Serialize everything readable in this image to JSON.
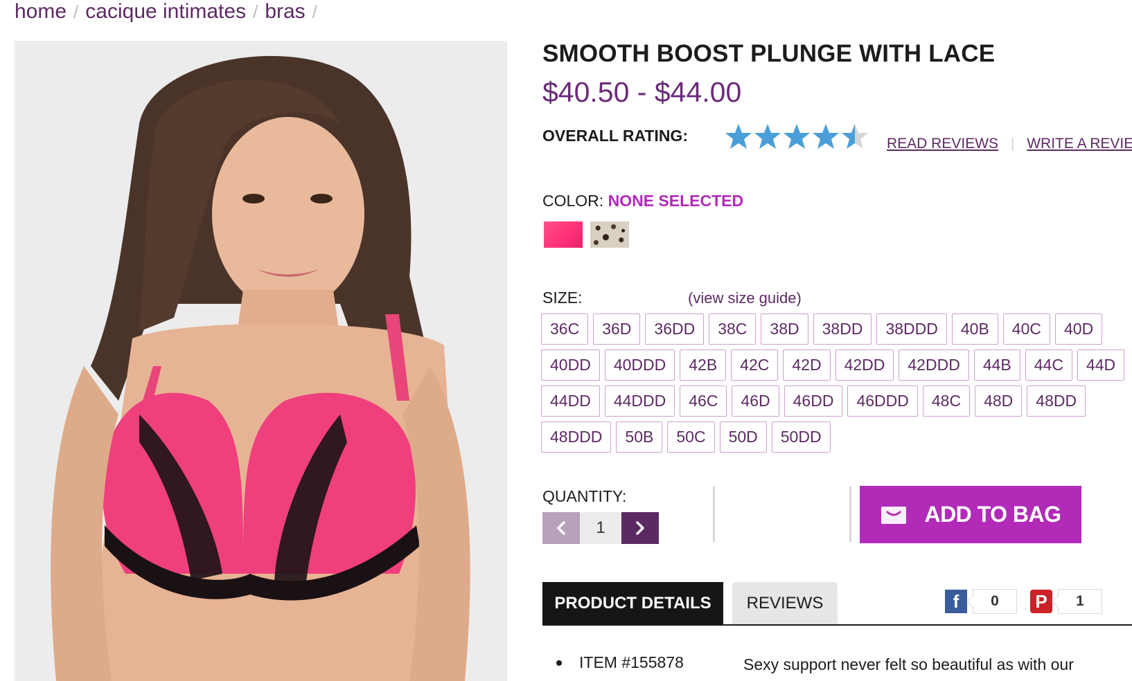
{
  "breadcrumb": {
    "items": [
      "home",
      "cacique intimates",
      "bras"
    ],
    "separator": "/"
  },
  "product": {
    "title": "SMOOTH BOOST PLUNGE WITH LACE",
    "price": "$40.50 - $44.00",
    "image_alt_icon": "product-photo"
  },
  "rating": {
    "label": "OVERALL RATING:",
    "value": 4.5,
    "max": 5,
    "read_reviews": "READ REVIEWS",
    "separator": "|",
    "write_review": "WRITE A REVIEW"
  },
  "color": {
    "label": "COLOR:",
    "selected": "NONE SELECTED",
    "swatches": [
      {
        "name": "pink",
        "color": "#ff3f82"
      },
      {
        "name": "leopard",
        "color": "#d8d0c2"
      }
    ]
  },
  "size": {
    "label": "SIZE:",
    "guide_link": "(view size guide)",
    "rows": [
      [
        "36C",
        "36D",
        "36DD",
        "38C",
        "38D",
        "38DD",
        "38DDD",
        "40B",
        "40C",
        "40D"
      ],
      [
        "40DD",
        "40DDD",
        "42B",
        "42C",
        "42D",
        "42DD",
        "42DDD",
        "44B",
        "44C",
        "44D"
      ],
      [
        "44DD",
        "44DDD",
        "46C",
        "46D",
        "46DD",
        "46DDD",
        "48C",
        "48D",
        "48DD"
      ],
      [
        "48DDD",
        "50B",
        "50C",
        "50D",
        "50DD"
      ]
    ]
  },
  "quantity": {
    "label": "QUANTITY:",
    "value": "1",
    "decrement_icon": "chevron-left-icon",
    "increment_icon": "chevron-right-icon"
  },
  "add_to_bag": {
    "label": "ADD TO BAG",
    "icon": "shopping-bag-icon"
  },
  "tabs": [
    {
      "label": "PRODUCT DETAILS",
      "active": true
    },
    {
      "label": "REVIEWS",
      "active": false
    }
  ],
  "social": {
    "facebook": {
      "icon": "f",
      "count": "0"
    },
    "pinterest": {
      "icon": "P",
      "count": "1"
    }
  },
  "details": {
    "item_number": "ITEM #155878",
    "description": "Sexy support never felt so beautiful as with our"
  },
  "colors": {
    "brand_purple": "#5c2a63",
    "accent_magenta": "#b12bb8",
    "price_purple": "#6a2b78",
    "star_blue": "#4a9fd8"
  }
}
